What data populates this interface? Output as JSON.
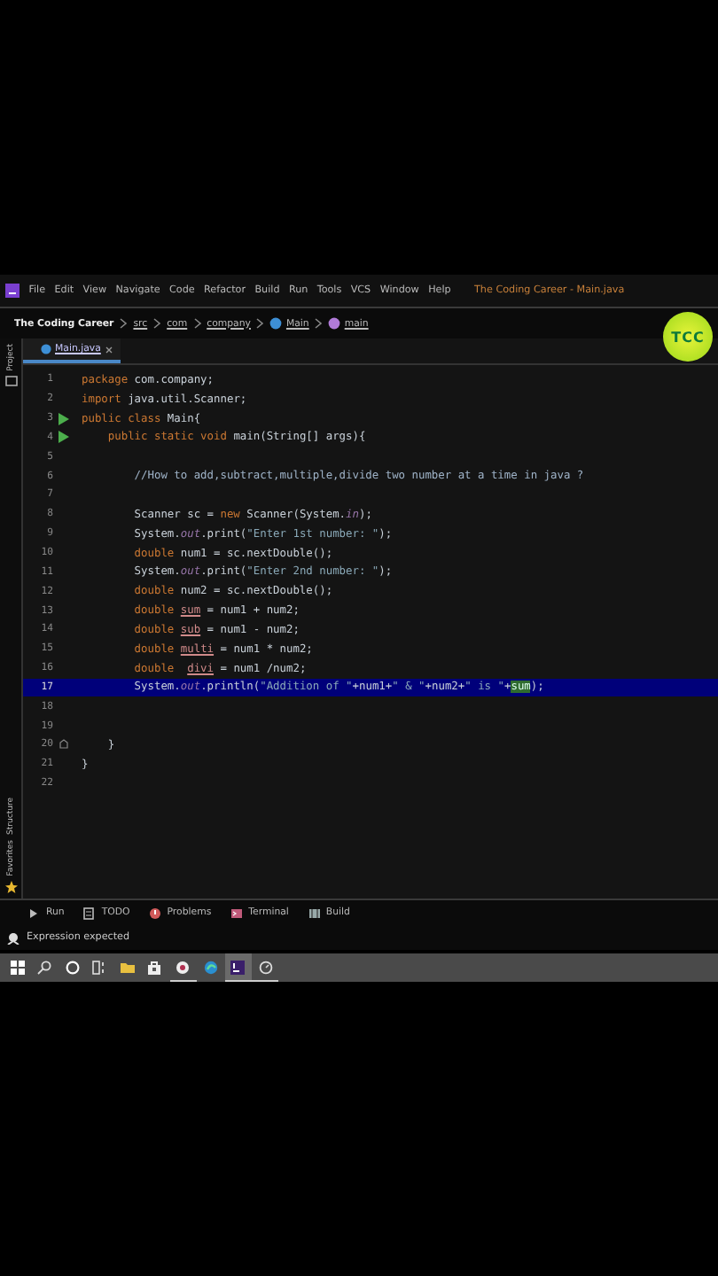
{
  "menu_bar": {
    "items": [
      "File",
      "Edit",
      "View",
      "Navigate",
      "Code",
      "Refactor",
      "Build",
      "Run",
      "Tools",
      "VCS",
      "Window",
      "Help"
    ],
    "title": "The Coding Career - Main.java"
  },
  "breadcrumbs": [
    {
      "label": "The Coding Career",
      "kind": "project"
    },
    {
      "label": "src",
      "kind": "folder"
    },
    {
      "label": "com",
      "kind": "folder"
    },
    {
      "label": "company",
      "kind": "folder"
    },
    {
      "label": "Main",
      "kind": "class"
    },
    {
      "label": "main",
      "kind": "method"
    }
  ],
  "logo": "TCC",
  "side_stripe": [
    {
      "label": "Project",
      "kind": "top"
    },
    {
      "label": "Structure",
      "kind": "bottom"
    },
    {
      "label": "Favorites",
      "kind": "bottom"
    }
  ],
  "editor_tabs": [
    {
      "label": "Main.java",
      "selected": true
    }
  ],
  "editor": {
    "lines": [
      {
        "number": "1",
        "current": false,
        "tokens": [
          {
            "text": "package",
            "kind": "keyword"
          },
          {
            "text": " com.company;",
            "kind": "plain"
          }
        ]
      },
      {
        "number": "2",
        "current": false,
        "tokens": [
          {
            "text": "import",
            "kind": "keyword"
          },
          {
            "text": " java.util.Scanner;",
            "kind": "plain"
          }
        ]
      },
      {
        "number": "3",
        "current": false,
        "gutter": {
          "kind": "run"
        },
        "tokens": [
          {
            "text": "public class",
            "kind": "keyword"
          },
          {
            "text": " Main{",
            "kind": "plain"
          }
        ]
      },
      {
        "number": "4",
        "current": false,
        "gutter": {
          "kind": "run"
        },
        "tokens": [
          {
            "text": "    public static void",
            "kind": "keyword"
          },
          {
            "text": " main(String[] args){",
            "kind": "plain"
          }
        ]
      },
      {
        "number": "5",
        "current": false
      },
      {
        "number": "6",
        "current": false,
        "tokens": [
          {
            "text": "        //How to add,subtract,multiple,divide two number at a time in java ?",
            "kind": "comment"
          }
        ]
      },
      {
        "number": "7",
        "current": false
      },
      {
        "number": "8",
        "current": false,
        "tokens": [
          {
            "text": "        Scanner sc = ",
            "kind": "plain"
          },
          {
            "text": "new",
            "kind": "keyword"
          },
          {
            "text": " Scanner(System.",
            "kind": "plain"
          },
          {
            "text": "in",
            "kind": "static"
          },
          {
            "text": ");",
            "kind": "plain"
          }
        ]
      },
      {
        "number": "9",
        "current": false,
        "tokens": [
          {
            "text": "        System.",
            "kind": "plain"
          },
          {
            "text": "out",
            "kind": "static"
          },
          {
            "text": ".print(",
            "kind": "plain"
          },
          {
            "text": "\"Enter 1st number: \"",
            "kind": "string"
          },
          {
            "text": ");",
            "kind": "plain"
          }
        ]
      },
      {
        "number": "10",
        "current": false,
        "tokens": [
          {
            "text": "        double",
            "kind": "keyword"
          },
          {
            "text": " num1 = sc.nextDouble();",
            "kind": "plain"
          }
        ]
      },
      {
        "number": "11",
        "current": false,
        "tokens": [
          {
            "text": "        System.",
            "kind": "plain"
          },
          {
            "text": "out",
            "kind": "static"
          },
          {
            "text": ".print(",
            "kind": "plain"
          },
          {
            "text": "\"Enter 2nd number: \"",
            "kind": "string"
          },
          {
            "text": ");",
            "kind": "plain"
          }
        ]
      },
      {
        "number": "12",
        "current": false,
        "tokens": [
          {
            "text": "        double",
            "kind": "keyword"
          },
          {
            "text": " num2 = sc.nextDouble();",
            "kind": "plain"
          }
        ]
      },
      {
        "number": "13",
        "current": false,
        "tokens": [
          {
            "text": "        double ",
            "kind": "keyword"
          },
          {
            "text": "sum",
            "kind": "unused"
          },
          {
            "text": " = num1 + num2;",
            "kind": "plain"
          }
        ]
      },
      {
        "number": "14",
        "current": false,
        "tokens": [
          {
            "text": "        double ",
            "kind": "keyword"
          },
          {
            "text": "sub",
            "kind": "unused"
          },
          {
            "text": " = num1 - num2;",
            "kind": "plain"
          }
        ]
      },
      {
        "number": "15",
        "current": false,
        "tokens": [
          {
            "text": "        double ",
            "kind": "keyword"
          },
          {
            "text": "multi",
            "kind": "unused"
          },
          {
            "text": " = num1 * num2;",
            "kind": "plain"
          }
        ]
      },
      {
        "number": "16",
        "current": false,
        "tokens": [
          {
            "text": "        double  ",
            "kind": "keyword"
          },
          {
            "text": "divi",
            "kind": "unused"
          },
          {
            "text": " = num1 /num2;",
            "kind": "plain"
          }
        ]
      },
      {
        "number": "17",
        "current": true,
        "tokens": [
          {
            "text": "        System.",
            "kind": "plain"
          },
          {
            "text": "out",
            "kind": "static"
          },
          {
            "text": ".println(",
            "kind": "plain"
          },
          {
            "text": "\"Addition of \"",
            "kind": "string"
          },
          {
            "text": "+num1+",
            "kind": "plain"
          },
          {
            "text": "\" & \"",
            "kind": "string"
          },
          {
            "text": "+num2+",
            "kind": "plain"
          },
          {
            "text": "\" is \"",
            "kind": "string"
          },
          {
            "text": "+",
            "kind": "plain"
          },
          {
            "text": "sum",
            "kind": "match"
          },
          {
            "text": ");",
            "kind": "plain"
          }
        ]
      },
      {
        "number": "18",
        "current": false
      },
      {
        "number": "19",
        "current": false
      },
      {
        "number": "20",
        "current": false,
        "gutter": {
          "kind": "fold"
        },
        "tokens": [
          {
            "text": "    }",
            "kind": "plain"
          }
        ]
      },
      {
        "number": "21",
        "current": false,
        "tokens": [
          {
            "text": "}",
            "kind": "plain"
          }
        ]
      },
      {
        "number": "22",
        "current": false
      }
    ]
  },
  "tool_tabs": [
    {
      "label": "Run",
      "kind": "run"
    },
    {
      "label": "TODO",
      "kind": "todo"
    },
    {
      "label": "Problems",
      "kind": "problems"
    },
    {
      "label": "Terminal",
      "kind": "terminal"
    },
    {
      "label": "Build",
      "kind": "build"
    }
  ],
  "status_bar": {
    "message": "Expression expected"
  },
  "taskbar": [
    {
      "kind": "windows",
      "running": false,
      "selected": false
    },
    {
      "kind": "search",
      "running": false,
      "selected": false
    },
    {
      "kind": "cortana",
      "running": false,
      "selected": false
    },
    {
      "kind": "taskview",
      "running": false,
      "selected": false
    },
    {
      "kind": "folder",
      "running": false,
      "selected": false
    },
    {
      "kind": "store",
      "running": false,
      "selected": false
    },
    {
      "kind": "disc",
      "running": true,
      "selected": false
    },
    {
      "kind": "edge",
      "running": false,
      "selected": false
    },
    {
      "kind": "ide",
      "running": true,
      "selected": true
    },
    {
      "kind": "clock",
      "running": true,
      "selected": false
    }
  ]
}
